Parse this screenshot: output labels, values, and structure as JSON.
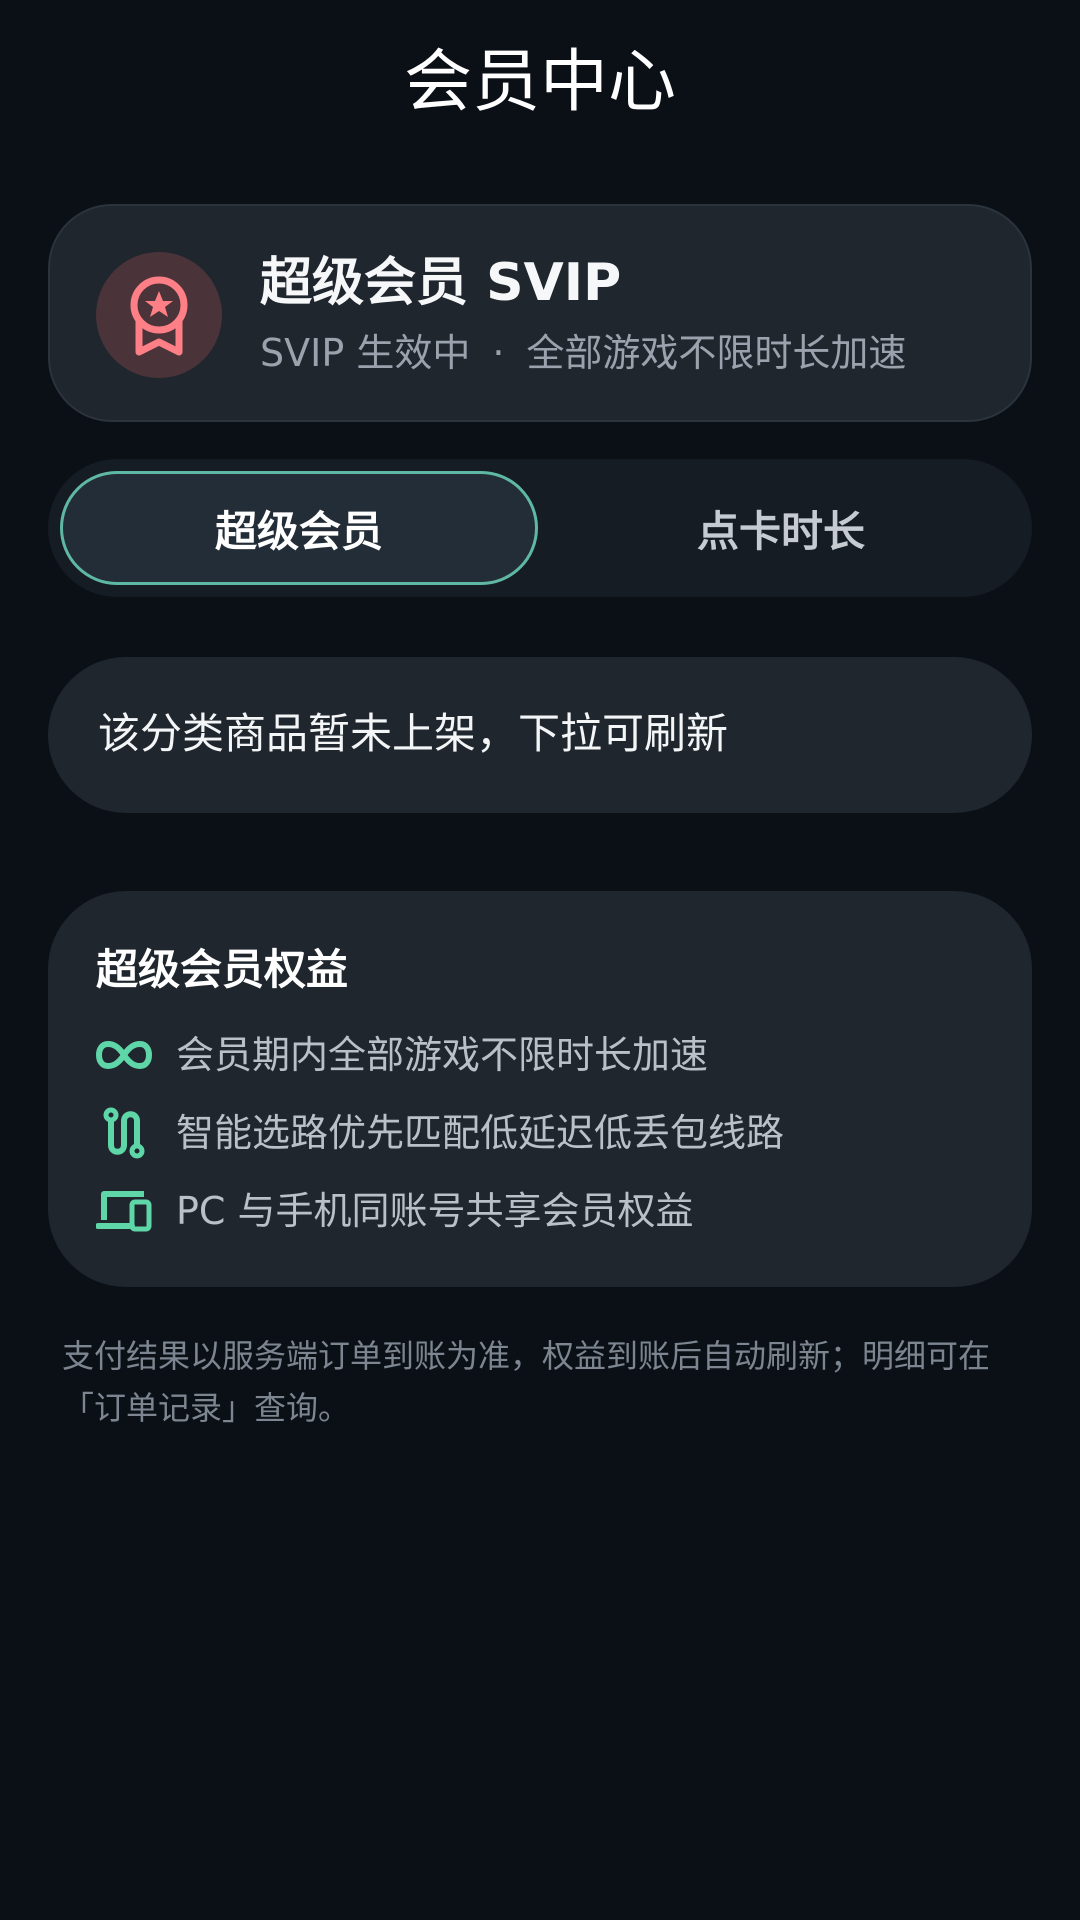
{
  "header": {
    "title": "会员中心"
  },
  "membership_status": {
    "icon": "award-ribbon-icon",
    "title": "超级会员 SVIP",
    "status": "SVIP 生效中",
    "separator": "·",
    "description": "全部游戏不限时长加速",
    "icon_color": "#ff7f86"
  },
  "tabs": [
    {
      "label": "超级会员",
      "active": true
    },
    {
      "label": "点卡时长",
      "active": false
    }
  ],
  "empty_state": {
    "message": "该分类商品暂未上架，下拉可刷新"
  },
  "benefits": {
    "title": "超级会员权益",
    "icon_color": "#5fd6a8",
    "items": [
      {
        "icon": "infinity-icon",
        "text": "会员期内全部游戏不限时长加速"
      },
      {
        "icon": "route-icon",
        "text": "智能选路优先匹配低延迟低丢包线路"
      },
      {
        "icon": "devices-icon",
        "text": "PC 与手机同账号共享会员权益"
      }
    ]
  },
  "footnote": "支付结果以服务端订单到账为准，权益到账后自动刷新；明细可在「订单记录」查询。",
  "colors": {
    "background": "#0b1017",
    "card": "#1f262e",
    "accent": "#5fb8a4"
  }
}
